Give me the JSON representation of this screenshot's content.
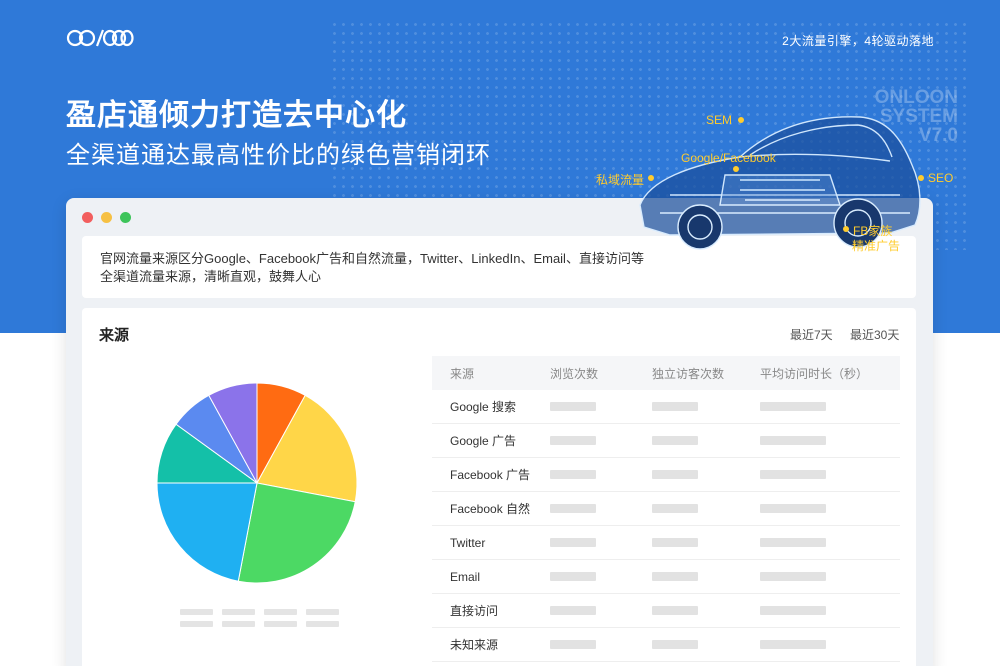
{
  "header": {
    "logo": "logo-icon",
    "tagline": "2大流量引擎，4轮驱动落地",
    "headline": "盈店通倾力打造去中心化",
    "subline": "全渠道通达最高性价比的绿色营销闭环",
    "watermark": [
      "ONLOON",
      "SYSTEM",
      "V7.0"
    ],
    "highlights": [
      {
        "label": "SEM"
      },
      {
        "label": "Google/Facebook"
      },
      {
        "label": "私域流量"
      },
      {
        "label": "SEO"
      },
      {
        "label": "FB家族"
      },
      {
        "label": "精准广告"
      }
    ],
    "accent": "#ffcc2e",
    "brand_blue": "#2f79d8"
  },
  "window": {
    "traffic_lights": [
      "#f25e5e",
      "#f6c043",
      "#3dc45a"
    ],
    "description": [
      "官网流量来源区分Google、Facebook广告和自然流量，Twitter、LinkedIn、Email、直接访问等",
      "全渠道流量来源，清晰直观，鼓舞人心"
    ],
    "panel": {
      "title": "来源",
      "ranges": [
        "最近7天",
        "最近30天"
      ],
      "table": {
        "headers": [
          "来源",
          "浏览次数",
          "独立访客次数",
          "平均访问时长（秒）"
        ],
        "rows": [
          "Google 搜索",
          "Google 广告",
          "Facebook 广告",
          "Facebook 自然",
          "Twitter",
          "Email",
          "直接访问",
          "未知来源"
        ]
      }
    }
  },
  "chart_data": {
    "type": "pie",
    "slices": [
      {
        "value": 8,
        "color": "#ff6b12"
      },
      {
        "value": 20,
        "color": "#ffd648"
      },
      {
        "value": 25,
        "color": "#4cd964"
      },
      {
        "value": 22,
        "color": "#1fb0f2"
      },
      {
        "value": 10,
        "color": "#14c0a8"
      },
      {
        "value": 7,
        "color": "#5b8af0"
      },
      {
        "value": 8,
        "color": "#8b73ea"
      }
    ]
  }
}
